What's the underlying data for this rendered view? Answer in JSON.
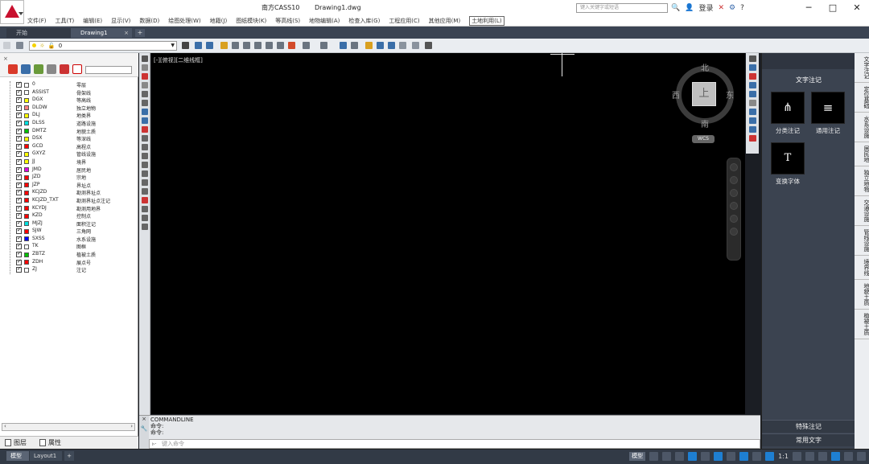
{
  "titlebar": {
    "app_name": "南方CASS10",
    "file_name": "Drawing1.dwg",
    "search_placeholder": "键入关键字或短语",
    "login_label": "登录",
    "help_label": "?"
  },
  "menu": {
    "items": [
      "文件(F)",
      "工具(T)",
      "编辑(E)",
      "显示(V)",
      "数据(D)",
      "绘图处理(W)",
      "地籍(J)",
      "图纸模块(K)",
      "等高线(S)",
      "地物编辑(A)",
      "检查入库(G)",
      "工程应用(C)",
      "其他应用(M)",
      "土地利用(L)"
    ],
    "active_index": 13
  },
  "tabs": {
    "start_label": "开始",
    "drawing_label": "Drawing1",
    "close_glyph": "×",
    "add_glyph": "+"
  },
  "toolbar": {
    "layer_combo_value": "0"
  },
  "layers": [
    {
      "code": "0",
      "name": "零层",
      "color": "#ffffff"
    },
    {
      "code": "ASSIST",
      "name": "骨架线",
      "color": "#ffffff"
    },
    {
      "code": "DGX",
      "name": "等高线",
      "color": "#ffff00"
    },
    {
      "code": "DLDW",
      "name": "独立地物",
      "color": "#ff8080"
    },
    {
      "code": "DLJ",
      "name": "地类界",
      "color": "#ffff00"
    },
    {
      "code": "DLSS",
      "name": "道路设施",
      "color": "#00e0e0"
    },
    {
      "code": "DMTZ",
      "name": "地貌土质",
      "color": "#00c000"
    },
    {
      "code": "DSX",
      "name": "等深线",
      "color": "#ffff00"
    },
    {
      "code": "GCD",
      "name": "高程点",
      "color": "#ff0000"
    },
    {
      "code": "GXYZ",
      "name": "管线设施",
      "color": "#ffff00"
    },
    {
      "code": "JJ",
      "name": "境界",
      "color": "#ffff00"
    },
    {
      "code": "JMD",
      "name": "居民地",
      "color": "#e000e0"
    },
    {
      "code": "JZD",
      "name": "宗地",
      "color": "#ff0000"
    },
    {
      "code": "JZP",
      "name": "界址点",
      "color": "#ff0000"
    },
    {
      "code": "KCJZD",
      "name": "勘测界址点",
      "color": "#ff0000"
    },
    {
      "code": "KCJZD_TXT",
      "name": "勘测界址点注记",
      "color": "#ff0000"
    },
    {
      "code": "KCYDJ",
      "name": "勘测用地界",
      "color": "#ff0000"
    },
    {
      "code": "KZD",
      "name": "控制点",
      "color": "#ff0000"
    },
    {
      "code": "MJZJ",
      "name": "面积注记",
      "color": "#00e0e0"
    },
    {
      "code": "SJW",
      "name": "三角网",
      "color": "#ff0000"
    },
    {
      "code": "SXSS",
      "name": "水系设施",
      "color": "#0000ff"
    },
    {
      "code": "TK",
      "name": "图框",
      "color": "#ffffff"
    },
    {
      "code": "ZBTZ",
      "name": "植被土质",
      "color": "#00c000"
    },
    {
      "code": "ZDH",
      "name": "展点号",
      "color": "#ff0000"
    },
    {
      "code": "ZJ",
      "name": "注记",
      "color": "#ffffff"
    }
  ],
  "left_tabs": {
    "layers_label": "图层",
    "props_label": "属性"
  },
  "canvas": {
    "viewport_label": "[-][俯视][二维线框]",
    "viewcube": {
      "north": "北",
      "south": "南",
      "east": "东",
      "west": "西",
      "face": "上",
      "wcs": "WCS"
    }
  },
  "right_palette": {
    "title": "文字注记",
    "items": [
      {
        "label": "分类注记",
        "glyph": "⋔"
      },
      {
        "label": "通用注记",
        "glyph": "≡"
      },
      {
        "label": "变换字体",
        "glyph": "T"
      }
    ],
    "bottom_items": [
      "特殊注记",
      "常用文字"
    ],
    "side_tabs": [
      "文字注记",
      "定位基础",
      "水系设施",
      "居民地",
      "独立地物",
      "交通设施",
      "管线设施",
      "境界线",
      "地貌土质",
      "植被土质"
    ]
  },
  "commandline": {
    "header": "COMMANDLINE",
    "lines": [
      "命令:",
      "命令:"
    ],
    "input_placeholder": "键入命令",
    "side_glyph": "×"
  },
  "statusbar": {
    "model_tab": "模型",
    "layout_tab": "Layout1",
    "add_tab": "+",
    "model_label": "模型",
    "scale_label": "1:1"
  }
}
